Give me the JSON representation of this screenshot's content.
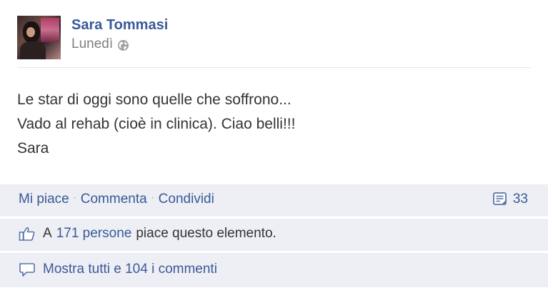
{
  "post": {
    "author": "Sara Tommasi",
    "timestamp": "Lunedì",
    "privacy_icon": "globe-icon",
    "body_lines": [
      "Le star di oggi sono quelle che soffrono...",
      "Vado al rehab (cioè in clinica). Ciao belli!!!",
      "Sara"
    ]
  },
  "actions": {
    "like_label": "Mi piace",
    "comment_label": "Commenta",
    "share_label": "Condividi",
    "separator": "·",
    "share_count": "33",
    "share_icon": "share-icon"
  },
  "likes": {
    "icon": "thumbs-up-icon",
    "prefix": "A",
    "people_link": "171 persone",
    "suffix": "piace questo elemento."
  },
  "comments": {
    "icon": "comment-bubble-icon",
    "view_all": "Mostra tutti e 104 i commenti"
  },
  "colors": {
    "link": "#3b5998",
    "text": "#333333",
    "muted": "#808080",
    "ufi_bg": "#edeff4"
  }
}
